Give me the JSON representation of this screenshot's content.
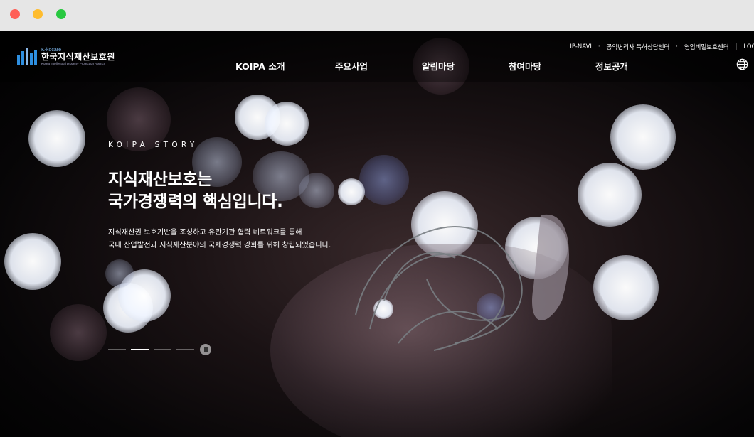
{
  "header": {
    "logo": {
      "sub": "K-kocare",
      "name": "한국지식재산보호원",
      "en": "Korea Intellectual property Protection Agency"
    },
    "util_links": [
      "IP-NAVI",
      "공익변리사 특허상담센터",
      "영업비밀보호센터",
      "LOGIN"
    ],
    "util_sep": "·",
    "util_bar": "|",
    "nav": [
      "KOIPA 소개",
      "주요사업",
      "알림마당",
      "참여마당",
      "정보공개"
    ],
    "language_icon": "globe-icon"
  },
  "hero": {
    "eyebrow": "KOIPA STORY",
    "title_line1": "지식재산보호는",
    "title_line2": "국가경쟁력의 핵심입니다.",
    "desc_line1": "지식재산권 보호기반을 조성하고 유관기관 협력 네트워크를 통해",
    "desc_line2": "국내 산업발전과 지식재산분야의 국제경쟁력 강화를 위해 창립되었습니다.",
    "slides_total": 4,
    "active_slide": 2,
    "pause_icon": "pause-icon"
  },
  "colors": {
    "accent": "#2e8fe0",
    "window_red": "#ff5f57",
    "window_yellow": "#febc2e",
    "window_green": "#28c840"
  }
}
